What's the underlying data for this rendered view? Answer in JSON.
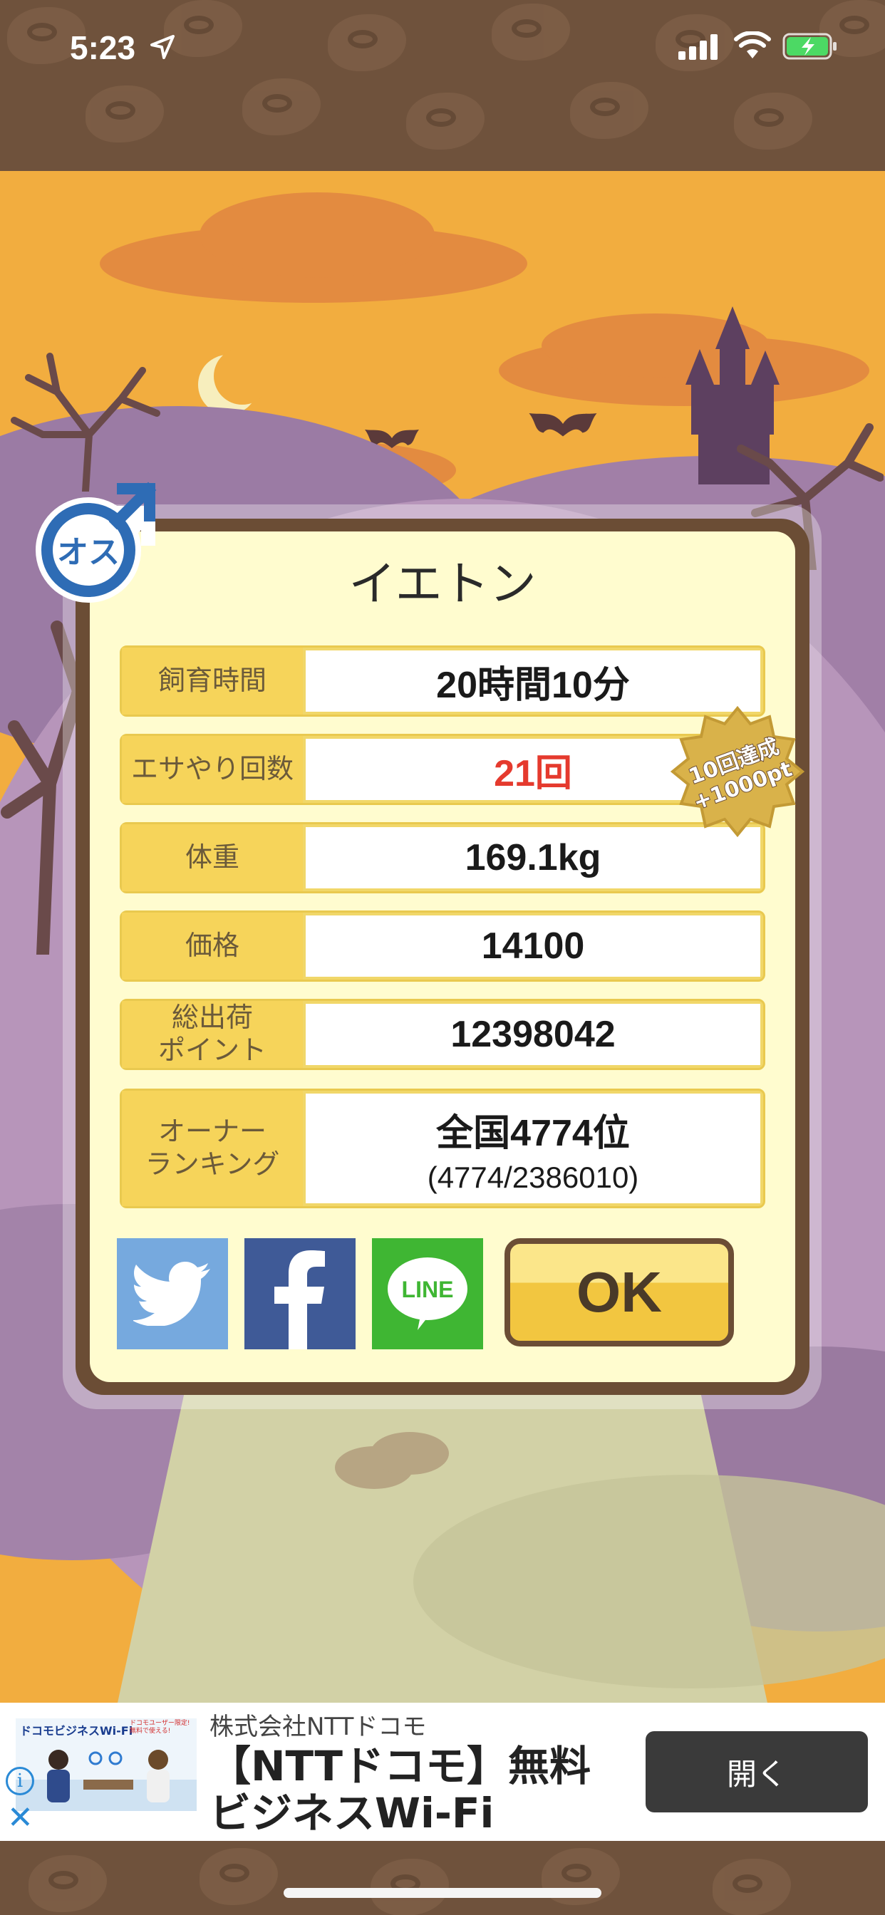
{
  "status_bar": {
    "time": "5:23"
  },
  "pet": {
    "name": "イエトン",
    "gender_label": "オス"
  },
  "stats": [
    {
      "label": "飼育時間",
      "value": "20時間10分"
    },
    {
      "label": "エサやり回数",
      "value": "21回"
    },
    {
      "label": "体重",
      "value": "169.1kg"
    },
    {
      "label": "価格",
      "value": "14100"
    },
    {
      "label": "総出荷\nポイント",
      "value": "12398042"
    },
    {
      "label": "オーナー\nランキング",
      "value": "全国4774位",
      "sub": "(4774/2386010)"
    }
  ],
  "badge": {
    "line1": "10回達成",
    "line2": "+1000pt"
  },
  "share": {
    "line_label": "LINE"
  },
  "ok_label": "OK",
  "ad": {
    "sponsor": "株式会社NTTドコモ",
    "headline_line1": "【NTTドコモ】無料",
    "headline_line2": "ビジネスWi-Fi",
    "open_label": "開く",
    "thumb_title": "ドコモビジネスWi-Fi",
    "thumb_note": "ドコモユーザー限定! 無料で使える!"
  },
  "colors": {
    "accent_red": "#e53a2e",
    "label_yellow": "#f6d45a",
    "frame_brown": "#6b4d35",
    "twitter": "#76a9de",
    "facebook": "#3f5a97",
    "line": "#3fb633"
  }
}
